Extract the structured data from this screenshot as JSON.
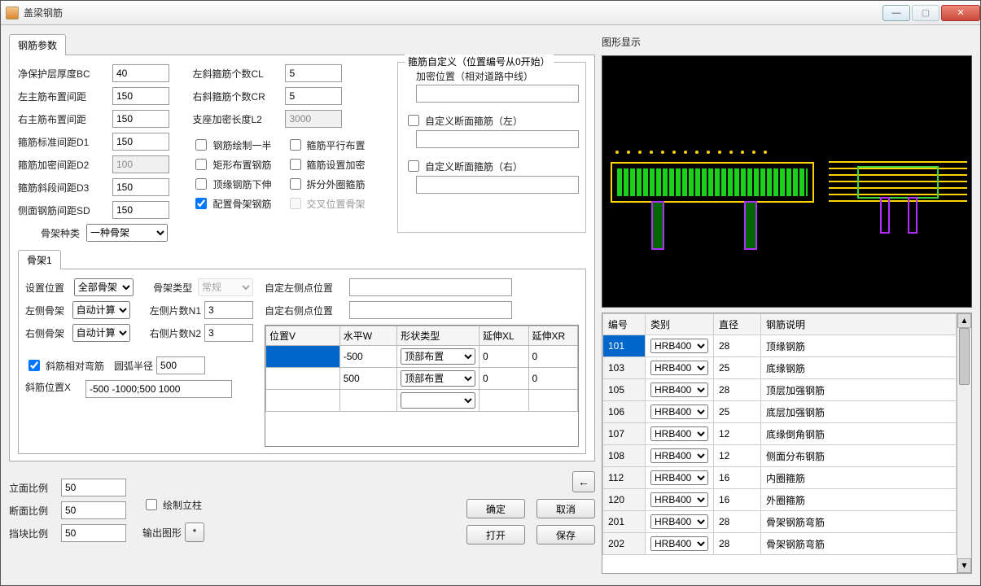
{
  "window": {
    "title": "盖梁钢筋"
  },
  "tabs": {
    "main": "钢筋参数"
  },
  "params_left": {
    "bc_label": "净保护层厚度BC",
    "bc": "40",
    "lspacing_label": "左主筋布置间距",
    "lspacing": "150",
    "rspacing_label": "右主筋布置间距",
    "rspacing": "150",
    "d1_label": "箍筋标准间距D1",
    "d1": "150",
    "d2_label": "箍筋加密间距D2",
    "d2": "100",
    "d3_label": "箍筋斜段间距D3",
    "d3": "150",
    "sd_label": "侧面钢筋间距SD",
    "sd": "150",
    "frame_type_label": "骨架种类",
    "frame_type": "一种骨架"
  },
  "params_mid": {
    "cl_label": "左斜箍筋个数CL",
    "cl": "5",
    "cr_label": "右斜箍筋个数CR",
    "cr": "5",
    "l2_label": "支座加密长度L2",
    "l2": "3000"
  },
  "checks": {
    "cb_half": "钢筋绘制一半",
    "cb_rect": "矩形布置钢筋",
    "cb_top": "顶缘钢筋下伸",
    "cb_frame": "配置骨架钢筋",
    "cb_parallel": "箍筋平行布置",
    "cb_dense": "箍筋设置加密",
    "cb_split": "拆分外圈箍筋",
    "cb_cross": "交叉位置骨架"
  },
  "stirrup_box": {
    "legend": "箍筋自定义（位置编号从0开始）",
    "dense_label": "加密位置（相对道路中线）",
    "custom_left": "自定义断面箍筋（左）",
    "custom_right": "自定义断面箍筋（右）"
  },
  "frame_tab": "骨架1",
  "frame": {
    "set_pos_label": "设置位置",
    "set_pos": "全部骨架",
    "ftype_label": "骨架类型",
    "ftype": "常规",
    "left_frame_label": "左侧骨架",
    "left_frame": "自动计算",
    "right_frame_label": "右侧骨架",
    "right_frame": "自动计算",
    "n1_label": "左侧片数N1",
    "n1": "3",
    "n2_label": "右侧片数N2",
    "n2": "3",
    "custom_left_label": "自定左侧点位置",
    "custom_right_label": "自定右侧点位置",
    "cb_rel": "斜筋相对弯筋",
    "arc_label": "圆弧半径",
    "arc": "500",
    "xpos_label": "斜筋位置X",
    "xpos": "-500 -1000;500 1000"
  },
  "frame_grid": {
    "headers": {
      "v": "位置V",
      "w": "水平W",
      "shape": "形状类型",
      "xl": "延伸XL",
      "xr": "延伸XR"
    },
    "row1": {
      "v": "",
      "w": "-500",
      "shape": "顶部布置",
      "xl": "0",
      "xr": "0"
    },
    "row2": {
      "v": "",
      "w": "500",
      "shape": "顶部布置",
      "xl": "0",
      "xr": "0"
    }
  },
  "ratios": {
    "elev_label": "立面比例",
    "elev": "50",
    "sec_label": "断面比例",
    "sec": "50",
    "block_label": "挡块比例",
    "block": "50",
    "draw_col_label": "绘制立柱",
    "out_label": "输出图形",
    "out_btn": "*"
  },
  "buttons": {
    "ok": "确定",
    "cancel": "取消",
    "open": "打开",
    "save": "保存"
  },
  "right_title": "图形显示",
  "rebar_grid": {
    "headers": {
      "no": "编号",
      "cat": "类别",
      "dia": "直径",
      "desc": "钢筋说明"
    },
    "rows": [
      {
        "no": "101",
        "cat": "HRB400",
        "dia": "28",
        "desc": "顶缘钢筋"
      },
      {
        "no": "103",
        "cat": "HRB400",
        "dia": "25",
        "desc": "底缘钢筋"
      },
      {
        "no": "105",
        "cat": "HRB400",
        "dia": "28",
        "desc": "顶层加强钢筋"
      },
      {
        "no": "106",
        "cat": "HRB400",
        "dia": "25",
        "desc": "底层加强钢筋"
      },
      {
        "no": "107",
        "cat": "HRB400",
        "dia": "12",
        "desc": "底缘倒角钢筋"
      },
      {
        "no": "108",
        "cat": "HRB400",
        "dia": "12",
        "desc": "侧面分布钢筋"
      },
      {
        "no": "112",
        "cat": "HRB400",
        "dia": "16",
        "desc": "内圈箍筋"
      },
      {
        "no": "120",
        "cat": "HRB400",
        "dia": "16",
        "desc": "外圈箍筋"
      },
      {
        "no": "201",
        "cat": "HRB400",
        "dia": "28",
        "desc": "骨架钢筋弯筋"
      },
      {
        "no": "202",
        "cat": "HRB400",
        "dia": "28",
        "desc": "骨架钢筋弯筋"
      }
    ]
  }
}
